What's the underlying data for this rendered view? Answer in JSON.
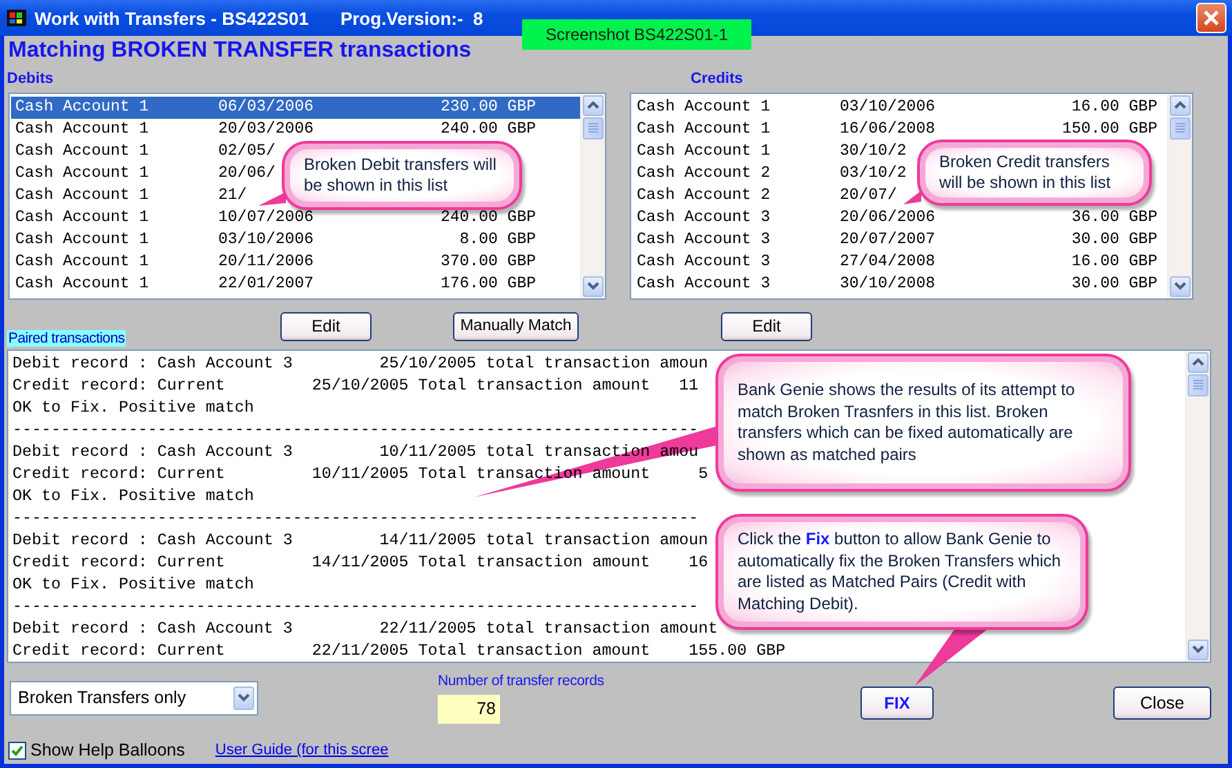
{
  "window": {
    "title": "Work with Transfers - BS422S01",
    "version": "Prog.Version:-  8",
    "badge": "Screenshot BS422S01-1"
  },
  "heading": "Matching BROKEN TRANSFER transactions",
  "debits": {
    "label": "Debits",
    "rows": [
      {
        "account": "Cash Account 1",
        "date": "06/03/2006",
        "amount": "230.00 GBP",
        "selected": true
      },
      {
        "account": "Cash Account 1",
        "date": "20/03/2006",
        "amount": "240.00 GBP",
        "selected": false
      },
      {
        "account": "Cash Account 1",
        "date": "02/05/",
        "selected": false
      },
      {
        "account": "Cash Account 1",
        "date": "20/06/",
        "selected": false
      },
      {
        "account": "Cash Account 1",
        "date": "21/",
        "selected": false
      },
      {
        "account": "Cash Account 1",
        "date": "10/07/2006",
        "amount": "240.00 GBP",
        "selected": false
      },
      {
        "account": "Cash Account 1",
        "date": "03/10/2006",
        "amount": "8.00 GBP",
        "selected": false
      },
      {
        "account": "Cash Account 1",
        "date": "20/11/2006",
        "amount": "370.00 GBP",
        "selected": false
      },
      {
        "account": "Cash Account 1",
        "date": "22/01/2007",
        "amount": "176.00 GBP",
        "selected": false
      }
    ]
  },
  "credits": {
    "label": "Credits",
    "rows": [
      {
        "account": "Cash Account 1",
        "date": "03/10/2006",
        "amount": "16.00 GBP",
        "selected": false
      },
      {
        "account": "Cash Account 1",
        "date": "16/06/2008",
        "amount": "150.00 GBP",
        "selected": false
      },
      {
        "account": "Cash Account 1",
        "date": "30/10/2",
        "selected": false
      },
      {
        "account": "Cash Account 2",
        "date": "03/10/2",
        "selected": false
      },
      {
        "account": "Cash Account 2",
        "date": "20/07/",
        "selected": false
      },
      {
        "account": "Cash Account 3",
        "date": "20/06/2006",
        "amount": "36.00 GBP",
        "selected": false
      },
      {
        "account": "Cash Account 3",
        "date": "20/07/2007",
        "amount": "30.00 GBP",
        "selected": false
      },
      {
        "account": "Cash Account 3",
        "date": "27/04/2008",
        "amount": "16.00 GBP",
        "selected": false
      },
      {
        "account": "Cash Account 3",
        "date": "30/10/2008",
        "amount": "30.00 GBP",
        "selected": false
      }
    ]
  },
  "buttons": {
    "debit_edit": "Edit",
    "manual_match": "Manually Match",
    "credit_edit": "Edit"
  },
  "paired": {
    "label": "Paired transactions",
    "lines": [
      "Debit record : Cash Account 3         25/10/2005 total transaction amoun",
      "Credit record: Current         25/10/2005 Total transaction amount   11",
      "OK to Fix. Positive match",
      "-----------------------------------------------------------------------",
      "Debit record : Cash Account 3         10/11/2005 total transaction amou",
      "Credit record: Current         10/11/2005 Total transaction amount     5",
      "OK to Fix. Positive match",
      "-----------------------------------------------------------------------",
      "Debit record : Cash Account 3         14/11/2005 total transaction amoun",
      "Credit record: Current         14/11/2005 Total transaction amount    16",
      "OK to Fix. Positive match",
      "-----------------------------------------------------------------------",
      "Debit record : Cash Account 3         22/11/2005 total transaction amount",
      "Credit record: Current         22/11/2005 Total transaction amount    155.00 GBP"
    ]
  },
  "filter": {
    "value": "Broken Transfers only"
  },
  "record_count": {
    "label": "Number of transfer records",
    "value": "78"
  },
  "fix_button": "FIX",
  "close_button": "Close",
  "show_help": {
    "label": "Show Help Balloons",
    "checked": true
  },
  "user_guide_link": "User Guide (for this scree",
  "balloons": [
    {
      "text": "Broken Debit transfers will be shown in this list"
    },
    {
      "text": "Broken Credit transfers will be shown in this list"
    },
    {
      "text": "Bank Genie shows the results of its attempt to match Broken Trasnfers in this list. Broken transfers which can be fixed automatically are shown as matched pairs"
    },
    {
      "text": "Click the **Fix** button to allow Bank Genie to automatically fix the Broken Transfers which are listed as Matched Pairs (Credit with Matching Debit)."
    }
  ]
}
